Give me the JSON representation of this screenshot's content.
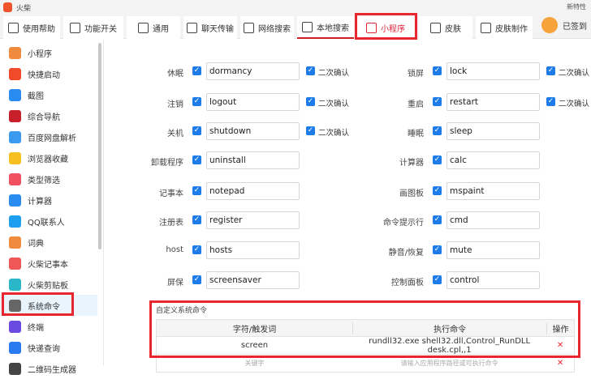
{
  "app": {
    "title": "火柴",
    "new_features": "新特性",
    "signed": "已签到"
  },
  "tabs": [
    {
      "label": "使用帮助"
    },
    {
      "label": "功能开关"
    },
    {
      "label": "通用"
    },
    {
      "label": "聊天传输"
    },
    {
      "label": "网络搜索"
    },
    {
      "label": "本地搜索"
    },
    {
      "label": "小程序"
    },
    {
      "label": "皮肤"
    },
    {
      "label": "皮肤制作"
    }
  ],
  "sidebar": {
    "items": [
      {
        "label": "小程序",
        "color": "#f08a3c"
      },
      {
        "label": "快捷启动",
        "color": "#f04a2a"
      },
      {
        "label": "截图",
        "color": "#2a8cf0"
      },
      {
        "label": "综合导航",
        "color": "#c8202a"
      },
      {
        "label": "百度网盘解析",
        "color": "#3a9af0"
      },
      {
        "label": "浏览器收藏",
        "color": "#f5c020"
      },
      {
        "label": "类型筛选",
        "color": "#f05060"
      },
      {
        "label": "计算器",
        "color": "#2a8cf0"
      },
      {
        "label": "QQ联系人",
        "color": "#1ea0f0"
      },
      {
        "label": "词典",
        "color": "#f08a3c"
      },
      {
        "label": "火柴记事本",
        "color": "#f05858"
      },
      {
        "label": "火柴剪贴板",
        "color": "#2ab8c8"
      },
      {
        "label": "系统命令",
        "color": "#666666"
      },
      {
        "label": "终端",
        "color": "#6a4ae0"
      },
      {
        "label": "快递查询",
        "color": "#2a7af0"
      },
      {
        "label": "二维码生成器",
        "color": "#444444"
      }
    ]
  },
  "confirm_label": "二次确认",
  "commands": [
    {
      "label": "休眠",
      "value": "dormancy",
      "confirm": true
    },
    {
      "label": "锁屏",
      "value": "lock",
      "confirm": true
    },
    {
      "label": "注销",
      "value": "logout",
      "confirm": true
    },
    {
      "label": "重启",
      "value": "restart",
      "confirm": true
    },
    {
      "label": "关机",
      "value": "shutdown",
      "confirm": true
    },
    {
      "label": "睡眠",
      "value": "sleep",
      "confirm": false
    },
    {
      "label": "卸载程序",
      "value": "uninstall",
      "confirm": false
    },
    {
      "label": "计算器",
      "value": "calc",
      "confirm": false
    },
    {
      "label": "记事本",
      "value": "notepad",
      "confirm": false
    },
    {
      "label": "画图板",
      "value": "mspaint",
      "confirm": false
    },
    {
      "label": "注册表",
      "value": "register",
      "confirm": false
    },
    {
      "label": "命令提示行",
      "value": "cmd",
      "confirm": false
    },
    {
      "label": "host",
      "value": "hosts",
      "confirm": false
    },
    {
      "label": "静音/恢复",
      "value": "mute",
      "confirm": false
    },
    {
      "label": "屏保",
      "value": "screensaver",
      "confirm": false
    },
    {
      "label": "控制面板",
      "value": "control",
      "confirm": false
    }
  ],
  "custom": {
    "title": "自定义系统命令",
    "headers": [
      "字符/触发词",
      "执行命令",
      "操作"
    ],
    "rows": [
      {
        "trigger": "screen",
        "command": "rundll32.exe shell32.dll,Control_RunDLL desk.cpl,,1",
        "action": "✕"
      }
    ],
    "new_row": {
      "trigger_placeholder": "关键字",
      "command_placeholder": "请输入应用程序路径或可执行命令",
      "action": "✕"
    }
  }
}
